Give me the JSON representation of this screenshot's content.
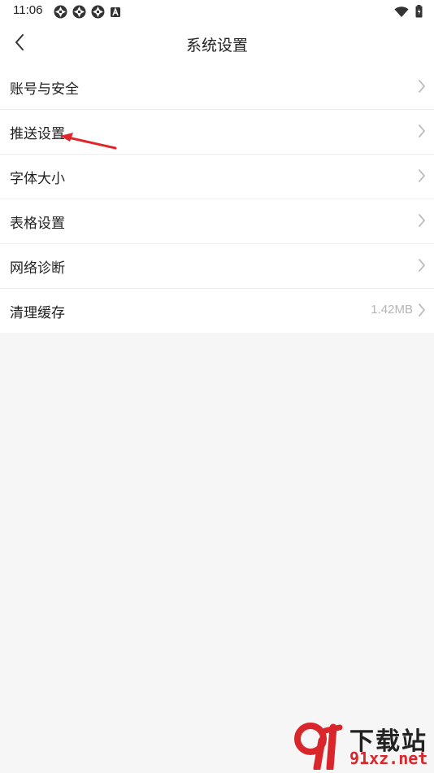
{
  "status_bar": {
    "time": "11:06",
    "notification_icons": [
      "aperture-icon",
      "aperture-icon",
      "aperture-icon",
      "a-badge-icon"
    ],
    "right_icons": [
      "wifi-icon",
      "battery-icon"
    ]
  },
  "header": {
    "title": "系统设置",
    "back_icon": "chevron-left-icon"
  },
  "settings_list": [
    {
      "label": "账号与安全",
      "value": ""
    },
    {
      "label": "推送设置",
      "value": ""
    },
    {
      "label": "字体大小",
      "value": ""
    },
    {
      "label": "表格设置",
      "value": ""
    },
    {
      "label": "网络诊断",
      "value": ""
    },
    {
      "label": "清理缓存",
      "value": "1.42MB"
    }
  ],
  "annotation": {
    "icon": "red-arrow-icon",
    "color": "#e0262b"
  },
  "watermark": {
    "line1": "下载站",
    "line2": "91xz.net",
    "accent_color": "#d8262b"
  },
  "colors": {
    "background": "#f6f6f6",
    "surface": "#ffffff",
    "text": "#222222",
    "secondary_text": "#b5b5b5",
    "chevron": "#bdbdbd"
  }
}
